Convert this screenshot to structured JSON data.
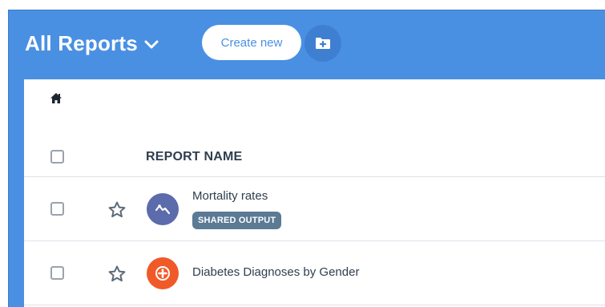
{
  "header": {
    "title": "All Reports",
    "create_label": "Create new"
  },
  "table": {
    "columns": {
      "report_name": "REPORT NAME"
    },
    "rows": [
      {
        "name": "Mortality rates",
        "badge": "SHARED OUTPUT",
        "icon": "line-chart-icon",
        "icon_color": "#5b6bab"
      },
      {
        "name": "Diabetes Diagnoses by Gender",
        "badge": "",
        "icon": "plus-circle-icon",
        "icon_color": "#f05a28"
      }
    ]
  },
  "colors": {
    "accent": "#4a90e2",
    "badge": "#5b7a94"
  }
}
